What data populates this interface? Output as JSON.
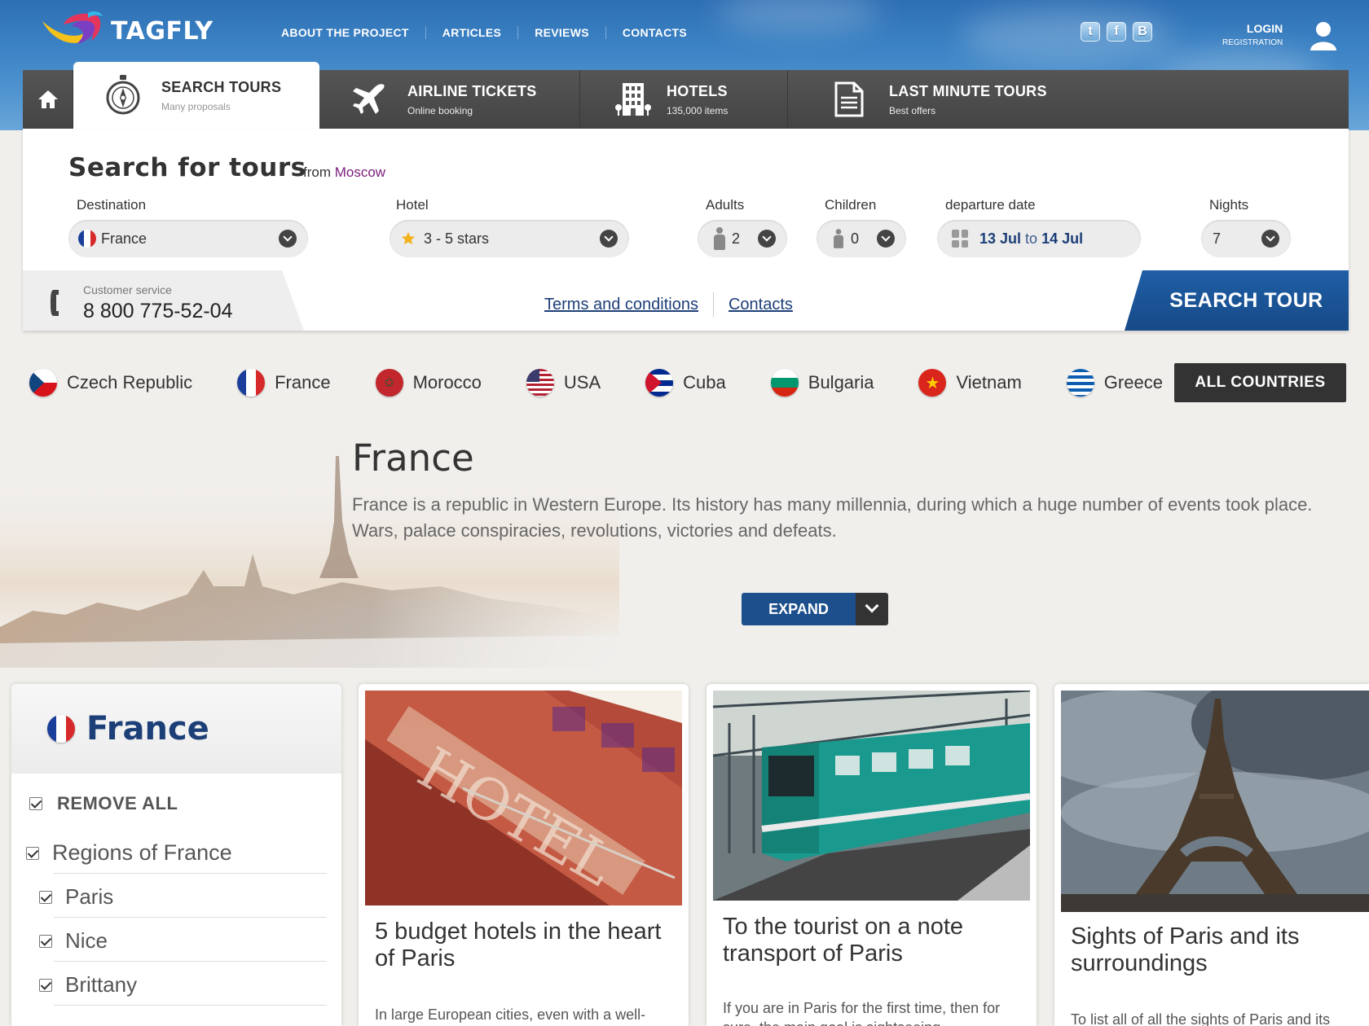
{
  "header": {
    "brand": "TAGFLY",
    "nav": [
      "ABOUT THE PROJECT",
      "ARTICLES",
      "REVIEWS",
      "CONTACTS"
    ],
    "social": [
      {
        "icon": "twitter-icon",
        "glyph": "t"
      },
      {
        "icon": "facebook-icon",
        "glyph": "f"
      },
      {
        "icon": "vk-icon",
        "glyph": "B"
      }
    ],
    "login": "LOGIN",
    "registration": "REGISTRATION"
  },
  "tabs": [
    {
      "title": "SEARCH TOURS",
      "sub": "Many proposals"
    },
    {
      "title": "AIRLINE TICKETS",
      "sub": "Online booking"
    },
    {
      "title": "HOTELS",
      "sub": "135,000 items"
    },
    {
      "title": "LAST MINUTE TOURS",
      "sub": "Best offers"
    }
  ],
  "search": {
    "title": "Search for tours",
    "from_prefix": "from",
    "from_city": "Moscow",
    "destination_label": "Destination",
    "destination_value": "France",
    "hotel_label": "Hotel",
    "hotel_value": "3 - 5 stars",
    "adults_label": "Adults",
    "adults_value": "2",
    "children_label": "Children",
    "children_value": "0",
    "date_label": "departure date",
    "date_from": "13 Jul",
    "date_to_word": "to",
    "date_to": "14 Jul",
    "nights_label": "Nights",
    "nights_value": "7",
    "service_label": "Customer service",
    "service_phone": "8 800 775-52-04",
    "terms_link": "Terms and conditions",
    "contacts_link": "Contacts",
    "search_button": "SEARCH TOUR"
  },
  "countries": [
    "Czech Republic",
    "France",
    "Morocco",
    "USA",
    "Cuba",
    "Bulgaria",
    "Vietnam",
    "Greece"
  ],
  "all_countries": "ALL COUNTRIES",
  "intro": {
    "title": "France",
    "line1": "France is a republic in Western Europe. Its history has many millennia, during which a huge number of events took place.",
    "line2": "Wars, palace conspiracies, revolutions, victories and defeats.",
    "expand": "EXPAND"
  },
  "sidebar": {
    "title": "France",
    "remove_all": "REMOVE ALL",
    "regions_label": "Regions of France",
    "regions": [
      "Paris",
      "Nice",
      "Brittany"
    ]
  },
  "articles": [
    {
      "title": "5 budget hotels in the heart of Paris",
      "desc": "In large European cities, even with a well-developed infrastructure, it can be difficult to"
    },
    {
      "title": "To the tourist on a note transport of Paris",
      "desc": "If you are in Paris for the first time, then for sure, the main goal is sightseeing"
    },
    {
      "title": "Sights of Paris and its surroundings",
      "desc": "To list all of all the sights of Paris and its"
    }
  ],
  "colors": {
    "brand_blue": "#1d3f78",
    "button_blue": "#1f5ea6",
    "header_blue": "#3b82c4",
    "dark_bar": "#4a4a4a"
  }
}
